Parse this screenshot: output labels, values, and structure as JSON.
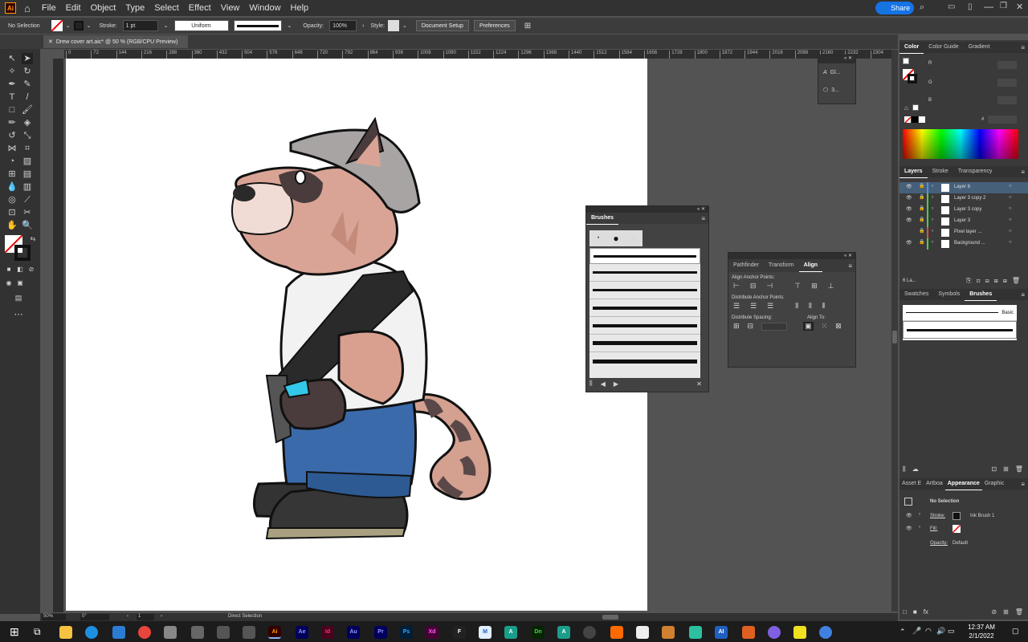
{
  "app": {
    "logo": "Ai"
  },
  "menu": [
    "File",
    "Edit",
    "Object",
    "Type",
    "Select",
    "Effect",
    "View",
    "Window",
    "Help"
  ],
  "share_label": "Share",
  "control": {
    "selection": "No Selection",
    "stroke_label": "Stroke:",
    "stroke_value": "1 pt",
    "profile": "Uniform",
    "opacity_label": "Opacity:",
    "opacity_value": "100%",
    "style_label": "Style:",
    "doc_setup": "Document Setup",
    "preferences": "Preferences"
  },
  "document_tab": "Drew cover art.aic* @ 50 % (RGB/CPU Preview)",
  "ruler_ticks": [
    "0",
    "72",
    "144",
    "216",
    "288",
    "360",
    "432",
    "504",
    "576",
    "648",
    "720",
    "792",
    "864",
    "936",
    "1008",
    "1080",
    "1152",
    "1224",
    "1296",
    "1368",
    "1440",
    "1512",
    "1584",
    "1656",
    "1728",
    "1800",
    "1872",
    "1944",
    "2016",
    "2088",
    "2160",
    "2232",
    "2304"
  ],
  "mini_panel": {
    "items": [
      "Gl...",
      "3..."
    ]
  },
  "brushes_float": {
    "title": "Brushes"
  },
  "align_panel": {
    "tabs": [
      "Pathfinder",
      "Transform",
      "Align"
    ],
    "align_anchor": "Align Anchor Points:",
    "distribute_anchor": "Distribute Anchor Points:",
    "distribute_spacing": "Distribute Spacing:",
    "align_to": "Align To:"
  },
  "color_panel": {
    "tabs": [
      "Color",
      "Color Guide",
      "Gradient"
    ],
    "channels": [
      "R",
      "G",
      "B"
    ],
    "hash": "#"
  },
  "layers_panel": {
    "tabs": [
      "Layers",
      "Stroke",
      "Transparency"
    ],
    "layers": [
      {
        "name": "Layer 6",
        "color": "#4a8ef0",
        "selected": true
      },
      {
        "name": "Layer 3 copy 2",
        "color": "#4ad04a",
        "selected": false
      },
      {
        "name": "Layer 3 copy",
        "color": "#4ad04a",
        "selected": false
      },
      {
        "name": "Layer 3",
        "color": "#4ad04a",
        "selected": false
      },
      {
        "name": "Pixel layer ...",
        "color": "#e04a4a",
        "selected": false
      },
      {
        "name": "Background ...",
        "color": "#4ad04a",
        "selected": false
      }
    ],
    "count": "6 La..."
  },
  "brushes_panel": {
    "tabs": [
      "Swatches",
      "Symbols",
      "Brushes"
    ],
    "basic_label": "Basic"
  },
  "appearance_panel": {
    "tabs": [
      "Asset E",
      "Artboa",
      "Appearance",
      "Graphic"
    ],
    "title": "No Selection",
    "stroke_label": "Stroke:",
    "stroke_value": "Ink Brush 1",
    "fill_label": "Fill:",
    "opacity_label": "Opacity:",
    "opacity_value": "Default"
  },
  "status": {
    "zoom": "50%",
    "angle": "0°",
    "artboard": "1",
    "tool": "Direct Selection"
  },
  "taskbar": {
    "time": "12:37 AM",
    "date": "2/1/2022"
  }
}
